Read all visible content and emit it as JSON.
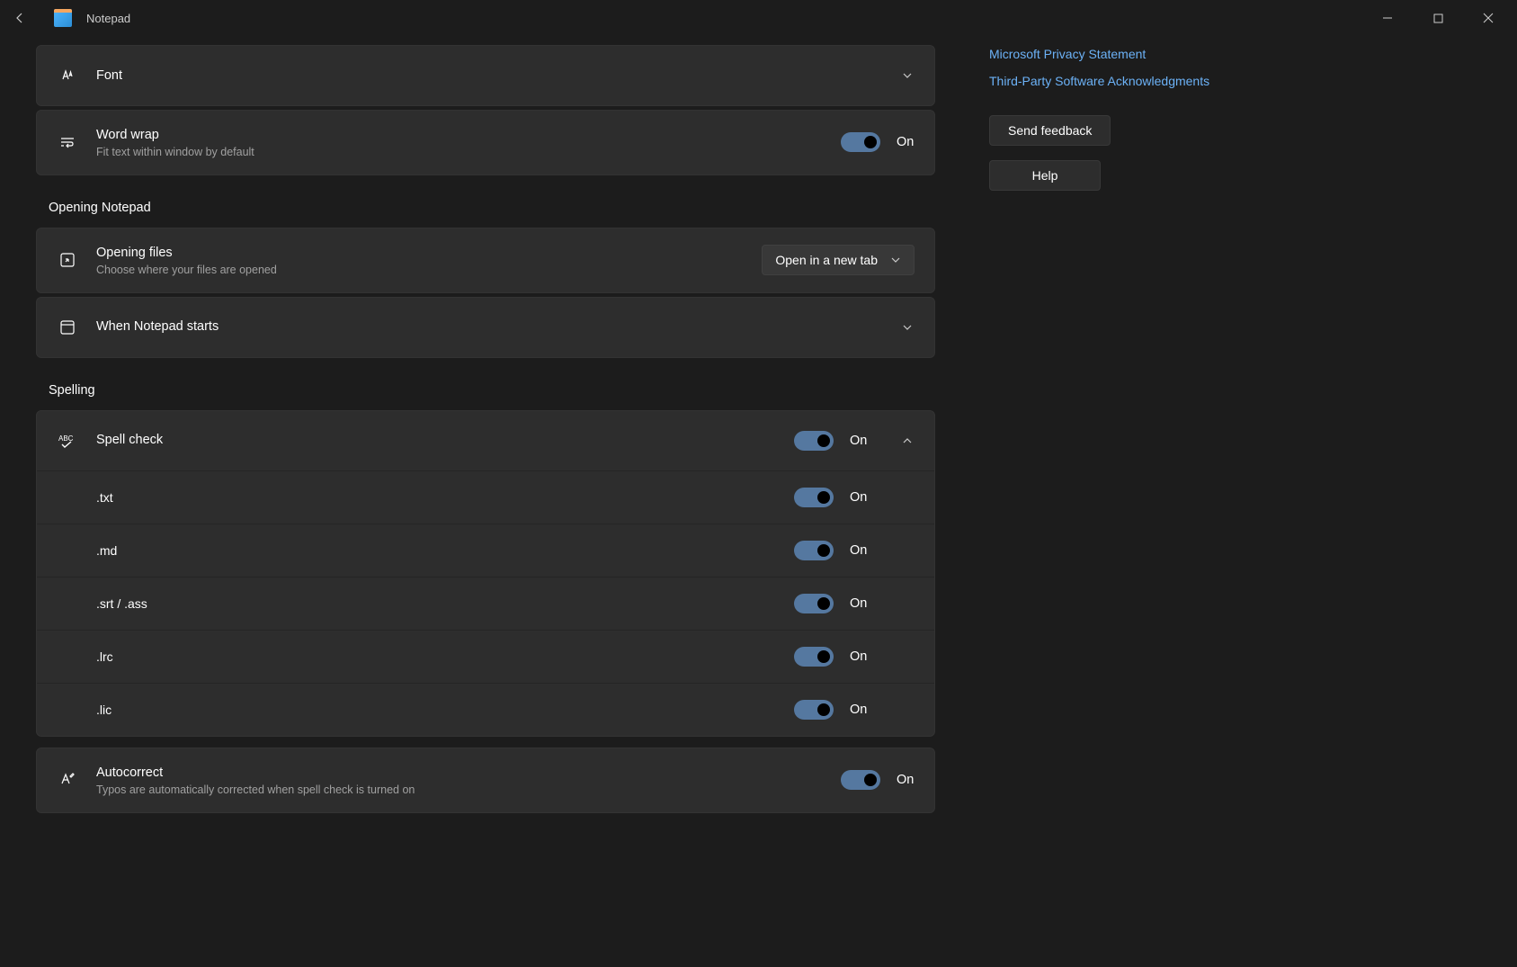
{
  "app": {
    "title": "Notepad"
  },
  "settings": {
    "font": {
      "label": "Font"
    },
    "wordwrap": {
      "label": "Word wrap",
      "description": "Fit text within window by default",
      "state": "On"
    },
    "opening_section": "Opening Notepad",
    "opening_files": {
      "label": "Opening files",
      "description": "Choose where your files are opened",
      "selected": "Open in a new tab"
    },
    "notepad_starts": {
      "label": "When Notepad starts"
    },
    "spelling_section": "Spelling",
    "spellcheck": {
      "label": "Spell check",
      "state": "On",
      "ext": [
        {
          "label": ".txt",
          "state": "On"
        },
        {
          "label": ".md",
          "state": "On"
        },
        {
          "label": ".srt / .ass",
          "state": "On"
        },
        {
          "label": ".lrc",
          "state": "On"
        },
        {
          "label": ".lic",
          "state": "On"
        }
      ]
    },
    "autocorrect": {
      "label": "Autocorrect",
      "description": "Typos are automatically corrected when spell check is turned on",
      "state": "On"
    }
  },
  "sidebar": {
    "privacy_link": "Microsoft Privacy Statement",
    "thirdparty_link": "Third-Party Software Acknowledgments",
    "feedback_btn": "Send feedback",
    "help_btn": "Help"
  }
}
